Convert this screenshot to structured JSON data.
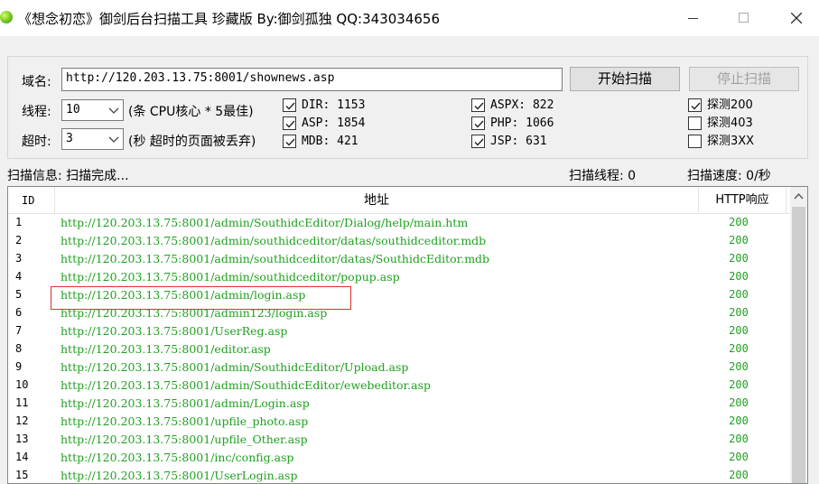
{
  "window": {
    "title": "《想念初恋》御剑后台扫描工具 珍藏版 By:御剑孤独 QQ:343034656"
  },
  "settings": {
    "domain_label": "域名:",
    "domain_value": "http://120.203.13.75:8001/shownews.asp",
    "start_label": "开始扫描",
    "stop_label": "停止扫描",
    "threads_label": "线程:",
    "threads_value": "10",
    "threads_hint": "(条 CPU核心 * 5最佳)",
    "timeout_label": "超时:",
    "timeout_value": "3",
    "timeout_hint": "(秒 超时的页面被丢弃)"
  },
  "dictionaries": [
    {
      "label": "DIR: 1153",
      "checked": true
    },
    {
      "label": "ASP: 1854",
      "checked": true
    },
    {
      "label": "MDB: 421",
      "checked": true
    },
    {
      "label": "ASPX: 822",
      "checked": true
    },
    {
      "label": "PHP: 1066",
      "checked": true
    },
    {
      "label": "JSP: 631",
      "checked": true
    }
  ],
  "probes": [
    {
      "label": "探测200",
      "checked": true
    },
    {
      "label": "探测403",
      "checked": false
    },
    {
      "label": "探测3XX",
      "checked": false
    }
  ],
  "status": {
    "info": "扫描信息: 扫描完成...",
    "threads": "扫描线程: 0",
    "speed": "扫描速度: 0/秒"
  },
  "table": {
    "columns": [
      "ID",
      "地址",
      "HTTP响应"
    ],
    "highlighted_row_index": 4,
    "rows": [
      {
        "id": "1",
        "url": "http://120.203.13.75:8001/admin/SouthidcEditor/Dialog/help/main.htm",
        "code": "200"
      },
      {
        "id": "2",
        "url": "http://120.203.13.75:8001/admin/southidceditor/datas/southidceditor.mdb",
        "code": "200"
      },
      {
        "id": "3",
        "url": "http://120.203.13.75:8001/admin/southidceditor/datas/SouthidcEditor.mdb",
        "code": "200"
      },
      {
        "id": "4",
        "url": "http://120.203.13.75:8001/admin/southidceditor/popup.asp",
        "code": "200"
      },
      {
        "id": "5",
        "url": "http://120.203.13.75:8001/admin/login.asp",
        "code": "200"
      },
      {
        "id": "6",
        "url": "http://120.203.13.75:8001/admin123/login.asp",
        "code": "200"
      },
      {
        "id": "7",
        "url": "http://120.203.13.75:8001/UserReg.asp",
        "code": "200"
      },
      {
        "id": "8",
        "url": "http://120.203.13.75:8001/editor.asp",
        "code": "200"
      },
      {
        "id": "9",
        "url": "http://120.203.13.75:8001/admin/SouthidcEditor/Upload.asp",
        "code": "200"
      },
      {
        "id": "10",
        "url": "http://120.203.13.75:8001/admin/SouthidcEditor/ewebeditor.asp",
        "code": "200"
      },
      {
        "id": "11",
        "url": "http://120.203.13.75:8001/admin/Login.asp",
        "code": "200"
      },
      {
        "id": "12",
        "url": "http://120.203.13.75:8001/upfile_photo.asp",
        "code": "200"
      },
      {
        "id": "13",
        "url": "http://120.203.13.75:8001/upfile_Other.asp",
        "code": "200"
      },
      {
        "id": "14",
        "url": "http://120.203.13.75:8001/inc/config.asp",
        "code": "200"
      },
      {
        "id": "15",
        "url": "http://120.203.13.75:8001/UserLogin.asp",
        "code": "200"
      }
    ]
  },
  "colors": {
    "url_text": "#20a020",
    "highlight_border": "#e03030"
  }
}
